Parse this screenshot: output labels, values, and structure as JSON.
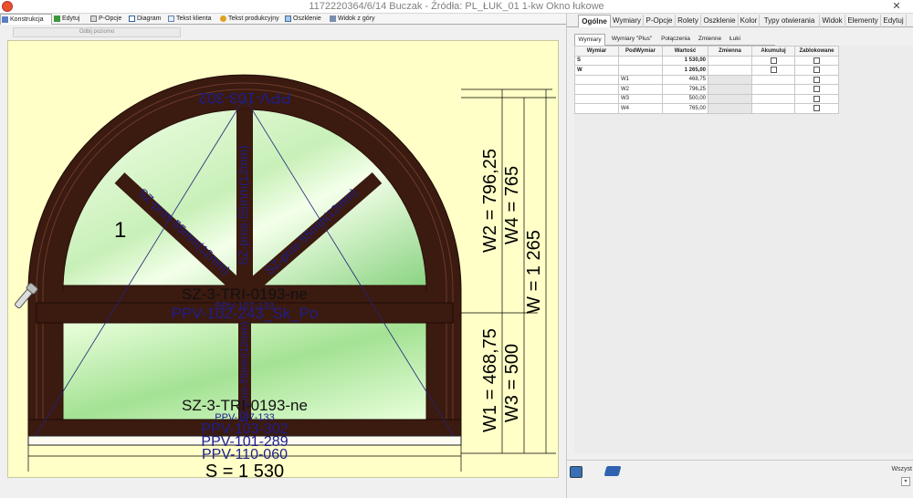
{
  "window": {
    "title": "1172220364/6/14 Buczak - Źródła: PL_ŁUK_01 1-kw Okno łukowe",
    "close_glyph": "✕"
  },
  "left_tabs": [
    {
      "label": "Konstrukcja",
      "icon": "construction-icon"
    },
    {
      "label": "Edytuj",
      "icon": "pencil-icon"
    },
    {
      "label": "P-Opcje",
      "icon": "options-icon"
    },
    {
      "label": "Diagram",
      "icon": "diagram-icon"
    },
    {
      "label": "Tekst klienta",
      "icon": "document-icon"
    },
    {
      "label": "Tekst produkcyjny",
      "icon": "gear-icon"
    },
    {
      "label": "Oszklenie",
      "icon": "glass-icon"
    },
    {
      "label": "Widok z góry",
      "icon": "top-view-icon"
    }
  ],
  "mirror_button": "Odbij poziomo",
  "drawing": {
    "sash_number": "1",
    "upper_sash_profile": "PPV-103-302",
    "upper_sash_label": "SZ-3-TRI-0193-ne",
    "transom_profile": "PPV-107-133",
    "transom_label": "PPV-102-243_Sk_Po",
    "mullion_label": "SZ-pros-55mm(12mm)",
    "lower_sash_label": "SZ-3-TRI-0193-ne",
    "lower_profile_1": "PPV-107-133",
    "bottom_profiles": [
      "PPV-103-302",
      "PPV-101-289",
      "PPV-110-060"
    ],
    "dim_s": "S = 1 530",
    "dim_w1": "W1 = 468,75",
    "dim_w2": "W2 = 796,25",
    "dim_w3": "W3 = 500",
    "dim_w4": "W4 = 765",
    "dim_w": "W = 1 265"
  },
  "right_tabs": [
    "Ogólne",
    "Wymiary",
    "P-Opcje",
    "Rolety",
    "Oszklenie",
    "Kolor",
    "Typy otwierania",
    "Widok",
    "Elementy",
    "Edytuj"
  ],
  "sub_tabs": [
    "Wymiary",
    "Wymiary \"Plus\"",
    "Połączenia",
    "Zmienne",
    "Łuki"
  ],
  "table": {
    "headers": [
      "Wymiar",
      "PodWymiar",
      "Wartość",
      "Zmienna",
      "Akumuluj",
      "Zablokowane"
    ],
    "rows": [
      {
        "wymiar": "S",
        "pod": "",
        "val": "1 530,00",
        "bold": true
      },
      {
        "wymiar": "W",
        "pod": "",
        "val": "1 265,00",
        "bold": true
      },
      {
        "wymiar": "",
        "pod": "W1",
        "val": "468,75",
        "bold": false
      },
      {
        "wymiar": "",
        "pod": "W2",
        "val": "796,25",
        "bold": false
      },
      {
        "wymiar": "",
        "pod": "W3",
        "val": "500,00",
        "bold": false
      },
      {
        "wymiar": "",
        "pod": "W4",
        "val": "765,00",
        "bold": false
      }
    ]
  },
  "bottom": {
    "all_label": "Wszyst",
    "scroll_glyph": "▾"
  },
  "colors": {
    "frame": "#3b1a10",
    "glass_light": "#f2ffe6",
    "glass_green": "#8fd98a",
    "canvas": "#ffffc7",
    "dim_line": "#1a1a8c"
  }
}
